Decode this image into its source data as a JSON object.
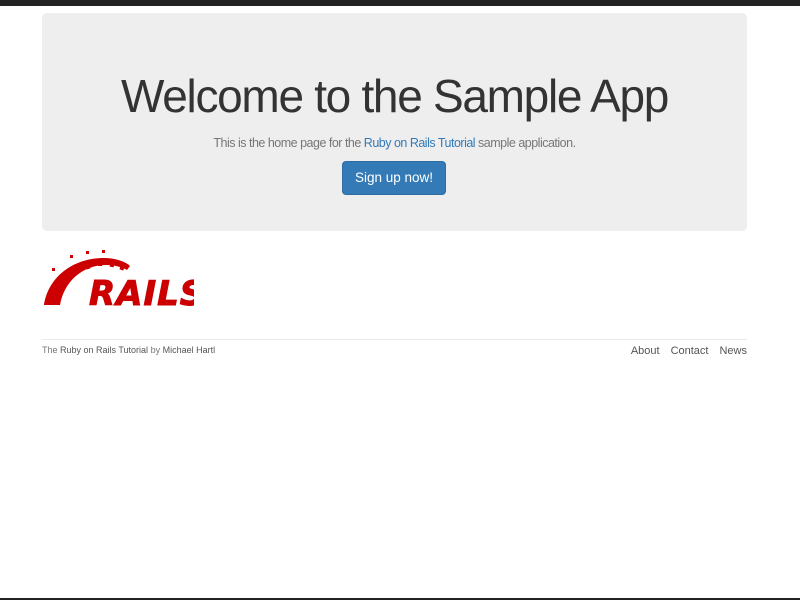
{
  "hero": {
    "title": "Welcome to the Sample App",
    "lead_prefix": "This is the home page for the ",
    "lead_link": "Ruby on Rails Tutorial",
    "lead_suffix": " sample application.",
    "signup_label": "Sign up now!"
  },
  "logo": {
    "icon": "rails-logo",
    "text": "RAILS",
    "color": "#cc0000"
  },
  "footer": {
    "credit_prefix": "The ",
    "credit_link": "Ruby on Rails Tutorial",
    "credit_middle": " by ",
    "author_link": "Michael Hartl",
    "nav": [
      "About",
      "Contact",
      "News"
    ]
  },
  "colors": {
    "accent": "#337ab7",
    "jumbotron_bg": "#eeeeee"
  }
}
